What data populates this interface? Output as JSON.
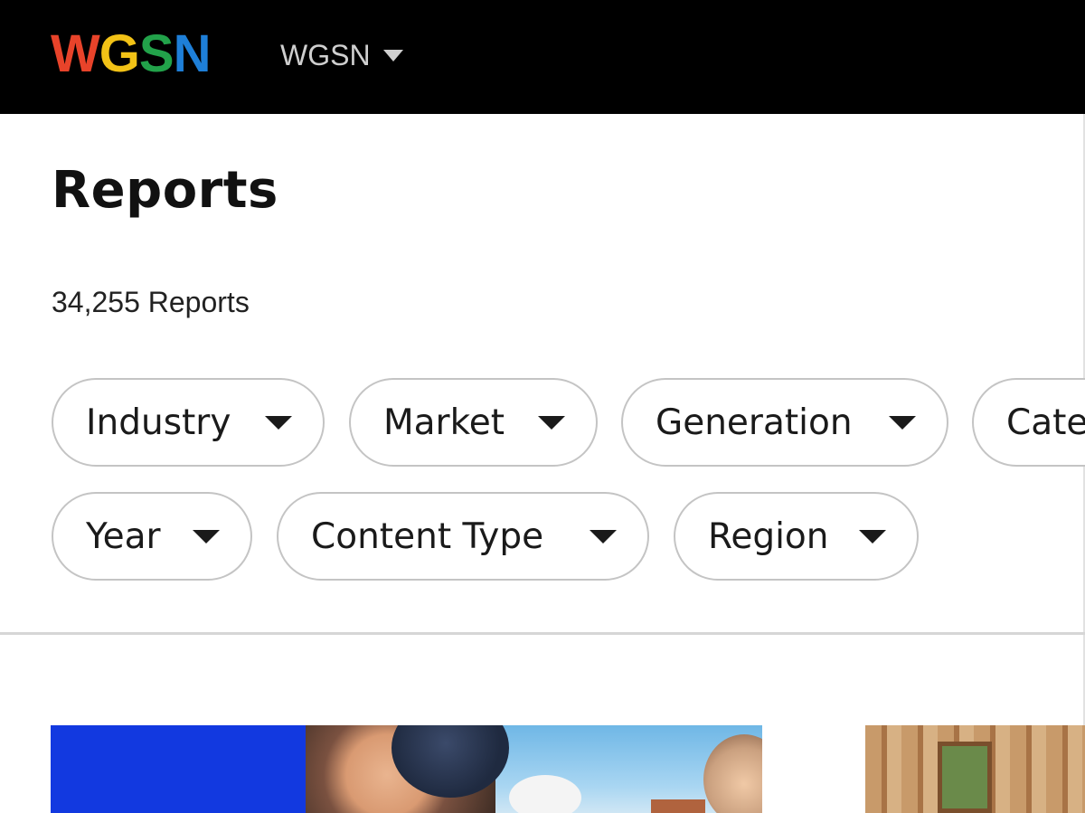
{
  "header": {
    "logo": [
      "W",
      "G",
      "S",
      "N"
    ],
    "org_switcher": {
      "label": "WGSN"
    }
  },
  "page": {
    "title": "Reports",
    "report_count": "34,255 Reports"
  },
  "filters": [
    {
      "label": "Industry"
    },
    {
      "label": "Market"
    },
    {
      "label": "Generation"
    },
    {
      "label": "Cate"
    },
    {
      "label": "Year"
    },
    {
      "label": "Content Type"
    },
    {
      "label": "Region"
    }
  ],
  "colors": {
    "logo_w": "#e8432a",
    "logo_g": "#f2c216",
    "logo_s": "#22a24a",
    "logo_n": "#1e7fd8",
    "card_blue": "#1239e0"
  }
}
